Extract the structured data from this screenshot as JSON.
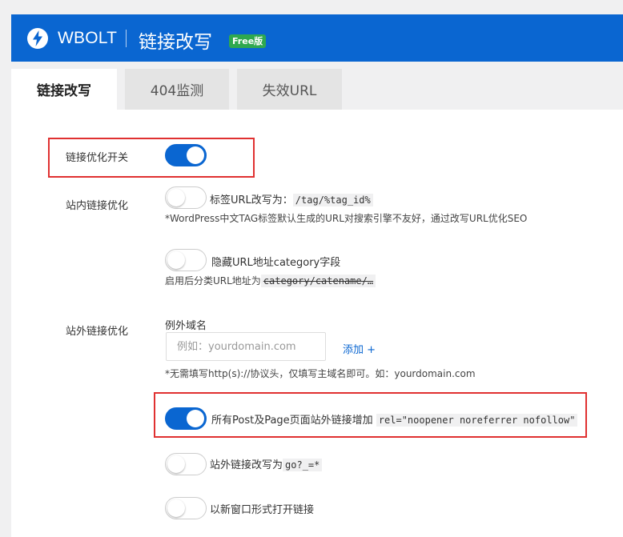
{
  "header": {
    "brand": "WBOLT",
    "title": "链接改写",
    "badge": "Free版"
  },
  "tabs": [
    {
      "label": "链接改写",
      "active": true
    },
    {
      "label": "404监测",
      "active": false
    },
    {
      "label": "失效URL",
      "active": false
    }
  ],
  "settings": {
    "master": {
      "label": "链接优化开关",
      "on": true
    },
    "internal": {
      "label": "站内链接优化",
      "tag_rewrite": {
        "text": "标签URL改写为：",
        "code": "/tag/%tag_id%",
        "on": false,
        "note": "*WordPress中文TAG标签默认生成的URL对搜索引擎不友好，通过改写URL优化SEO"
      },
      "hide_category": {
        "text": "隐藏URL地址category字段",
        "on": false,
        "note_prefix": "启用后分类URL地址为",
        "note_code": "category/catename/…"
      }
    },
    "external": {
      "label": "站外链接优化",
      "exception_label": "例外域名",
      "exception_placeholder": "例如：yourdomain.com",
      "add_label": "添加 +",
      "exception_note": "*无需填写http(s)://协议头，仅填写主域名即可。如：yourdomain.com",
      "rel_option": {
        "text": "所有Post及Page页面站外链接增加",
        "code": "rel=\"noopener noreferrer nofollow\"",
        "on": true
      },
      "go_rewrite": {
        "text": "站外链接改写为",
        "code": "go?_=*",
        "on": false
      },
      "new_window": {
        "text": "以新窗口形式打开链接",
        "on": false
      }
    }
  },
  "colors": {
    "primary": "#0a66d1",
    "badge": "#2fa84f",
    "highlight": "#e03131"
  }
}
